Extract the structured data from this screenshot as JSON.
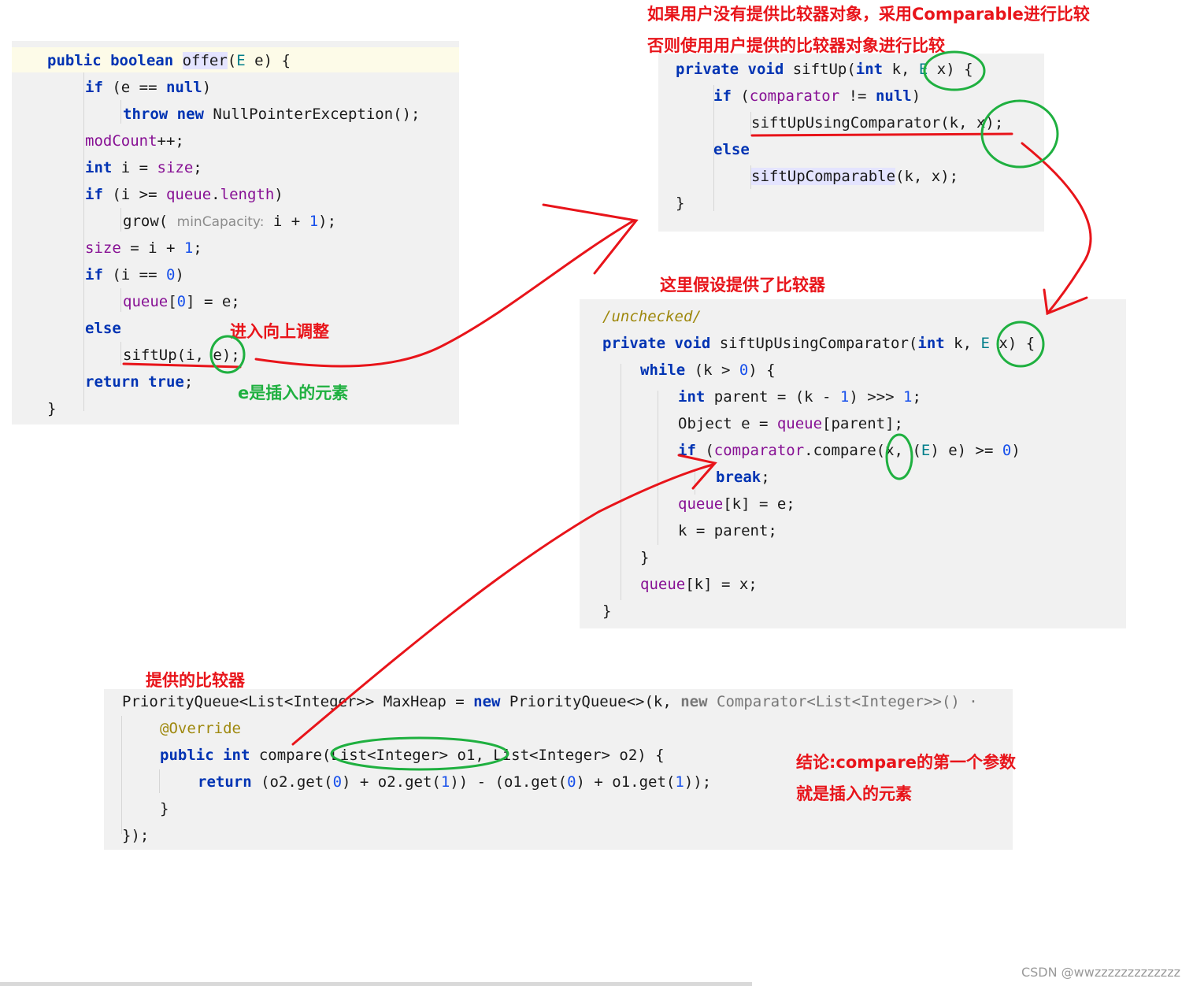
{
  "offer_code": {
    "l1": {
      "a": "public boolean ",
      "b": "offer",
      "c": "(",
      "d": "E",
      "e": " e) {"
    },
    "l2": {
      "a": "if",
      "b": " (e == ",
      "c": "null",
      "d": ")"
    },
    "l3": {
      "a": "throw new ",
      "b": "NullPointerException();"
    },
    "l4": {
      "a": "modCount",
      "b": "++;"
    },
    "l5": {
      "a": "int",
      "b": " i = ",
      "c": "size",
      "d": ";"
    },
    "l6": {
      "a": "if",
      "b": " (i >= ",
      "c": "queue",
      "d": ".",
      "e": "length",
      ")": ")"
    },
    "l7": {
      "a": "grow( ",
      "b": "minCapacity:",
      "c": " i + ",
      "d": "1",
      "e": ");"
    },
    "l8": {
      "a": "size",
      "b": " = i + ",
      "c": "1",
      "d": ";"
    },
    "l9": {
      "a": "if",
      "b": " (i == ",
      "c": "0",
      "d": ")"
    },
    "l10": {
      "a": "queue",
      "b": "[",
      "c": "0",
      "d": "] = e;"
    },
    "l11": {
      "a": "else"
    },
    "l12": {
      "a": "siftUp(i, e);"
    },
    "l13": {
      "a": "return true",
      "b": ";"
    },
    "l14": {
      "a": "}"
    }
  },
  "siftup_code": {
    "l1": {
      "a": "private void ",
      "b": "siftUp(",
      "c": "int",
      "d": " k, ",
      "e": "E",
      "f": " x) {"
    },
    "l2": {
      "a": "if",
      "b": " (",
      "c": "comparator",
      "d": " != ",
      "e": "null",
      ")": ")"
    },
    "l3": {
      "a": "siftUpUsingComparator(k, x);"
    },
    "l4": {
      "a": "else"
    },
    "l5": {
      "a": "siftUpComparable",
      "b": "(k, x);"
    },
    "l6": {
      "a": "}"
    }
  },
  "comparator_code": {
    "l0": {
      "a": "/unchecked/"
    },
    "l1": {
      "a": "private void ",
      "b": "siftUpUsingComparator(",
      "c": "int",
      "d": " k, ",
      "e": "E",
      "f": " x) {"
    },
    "l2": {
      "a": "while",
      "b": " (k > ",
      "c": "0",
      "d": ") {"
    },
    "l3": {
      "a": "int",
      "b": " parent = (k - ",
      "c": "1",
      "d": ") >>> ",
      "e": "1",
      "f": ";"
    },
    "l4": {
      "a": "Object e = ",
      "b": "queue",
      "c": "[parent];"
    },
    "l5": {
      "a": "if",
      "b": " (",
      "c": "comparator",
      "d": ".compare(x, (",
      "e": "E",
      "f": ") e) >= ",
      "g": "0",
      "h": ")"
    },
    "l6": {
      "a": "break",
      "b": ";"
    },
    "l7": {
      "a": "queue",
      "b": "[k] = e;"
    },
    "l8": {
      "a": "k = parent;"
    },
    "l9": {
      "a": "}"
    },
    "l10": {
      "a": "queue",
      "b": "[k] = x;"
    },
    "l11": {
      "a": "}"
    }
  },
  "pq_code": {
    "l1": {
      "a": "PriorityQueue<List<Integer>> MaxHeap = ",
      "b": "new ",
      "c": "PriorityQueue<>(k, ",
      "d": "new ",
      "e": "Comparator<List<Integer>>() ·"
    },
    "l2": {
      "a": "@Override"
    },
    "l3": {
      "a": "public int ",
      "b": "compare(List<Integer> o1, List<Integer> o2) {"
    },
    "l4": {
      "a": "return",
      "b": " (o2.get(",
      "c": "0",
      "d": ") + o2.get(",
      "e": "1",
      "f": ")) - (o1.get(",
      "g": "0",
      "h": ") + o1.get(",
      "i": "1",
      "j": "));"
    },
    "l5": {
      "a": "}"
    },
    "l6": {
      "a": "});"
    }
  },
  "notes": {
    "top1": "如果用户没有提供比较器对象，采用Comparable进行比较",
    "top2": "否则使用用户提供的比较器对象进行比较",
    "enter": "进入向上调整",
    "element": "e是插入的元素",
    "assume": "这里假设提供了比较器",
    "provided": "提供的比较器",
    "conclusion1": "结论:compare的第一个参数",
    "conclusion2": "就是插入的元素"
  },
  "footer": "CSDN @wwzzzzzzzzzzzzz",
  "colors": {
    "annotation_red": "#e8141a",
    "annotation_green": "#1fb040",
    "keyword": "#0033b3",
    "field": "#871094"
  }
}
